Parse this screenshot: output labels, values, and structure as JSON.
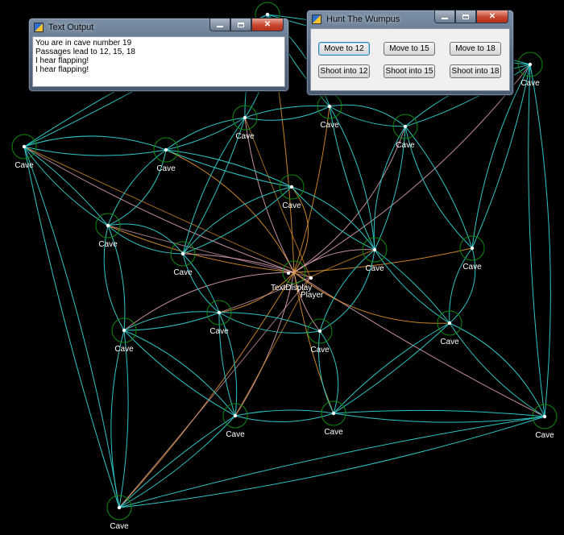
{
  "graph": {
    "node_label": "Cave",
    "center_labels": {
      "text_display": "TextDisplay",
      "player": "Player"
    },
    "colors": {
      "background": "#000000",
      "passage_edge": "#2fc5c5",
      "node_ring": "#0e8a0e",
      "node_dot": "#ffffff",
      "hub_edge_orange": "#e69a2e",
      "hub_edge_pink": "#e4a7b8",
      "label": "#ffffff"
    }
  },
  "text_output_window": {
    "title": "Text Output",
    "lines": [
      "You are in cave number 19",
      "Passages lead to 12, 15, 18",
      "I hear flapping!",
      "I hear flapping!"
    ]
  },
  "game_window": {
    "title": "Hunt The Wumpus",
    "move_buttons": [
      "Move to 12",
      "Move to 15",
      "Move to 18"
    ],
    "shoot_buttons": [
      "Shoot into 12",
      "Shoot into 15",
      "Shoot into 18"
    ]
  },
  "window_controls": {
    "close_glyph": "✕"
  }
}
